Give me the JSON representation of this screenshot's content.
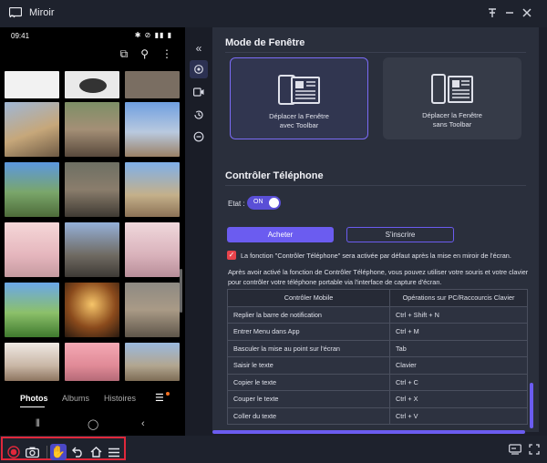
{
  "window": {
    "title": "Miroir",
    "buttons": [
      "pin",
      "minimize",
      "close"
    ]
  },
  "phone": {
    "status": {
      "time": "09:41"
    },
    "tabs": [
      {
        "label": "Photos",
        "active": true
      },
      {
        "label": "Albums",
        "active": false
      },
      {
        "label": "Histoires",
        "active": false
      }
    ]
  },
  "sidebar": {
    "items": [
      "collapse-icon",
      "settings-icon",
      "record-icon",
      "history-icon",
      "minus-icon"
    ],
    "selected": "settings-icon"
  },
  "settings": {
    "window_mode": {
      "title": "Mode de Fenêtre",
      "options": [
        {
          "line1": "Déplacer la Fenêtre",
          "line2": "avec Toolbar",
          "selected": true
        },
        {
          "line1": "Déplacer la Fenêtre",
          "line2": "sans Toolbar",
          "selected": false
        }
      ]
    },
    "phone_control": {
      "title": "Contrôler Téléphone",
      "state_label": "Etat :",
      "toggle_text": "ON",
      "buy_label": "Acheter",
      "register_label": "S'inscrire",
      "checkbox_text": "La fonction \"Contrôler Téléphone\" sera activée par défaut après la mise en miroir de l'écran.",
      "info_text": "Après avoir activé la fonction de Contrôler Téléphone, vous pouvez utiliser votre souris et votre clavier pour contrôler votre téléphone portable via l'interface de capture d'écran.",
      "table": {
        "headers": [
          "Contrôler Mobile",
          "Opérations sur PC/Raccourcis Clavier"
        ],
        "rows": [
          [
            "Replier la barre de notification",
            "Ctrl + Shift + N"
          ],
          [
            "Entrer Menu dans App",
            "Ctrl + M"
          ],
          [
            "Basculer la mise au point sur l'écran",
            "Tab"
          ],
          [
            "Saisir le texte",
            "Clavier"
          ],
          [
            "Copier le texte",
            "Ctrl + C"
          ],
          [
            "Couper le texte",
            "Ctrl + X"
          ],
          [
            "Coller du texte",
            "Ctrl + V"
          ]
        ]
      }
    }
  },
  "toolbar": {
    "left_tools": [
      "record-icon",
      "screenshot-icon",
      "hand-control-icon",
      "back-icon",
      "home-icon",
      "menu-icon"
    ],
    "right_tools": [
      "screen-settings-icon",
      "fullscreen-icon"
    ]
  },
  "colors": {
    "accent": "#6b5cf0",
    "record": "#e0283b",
    "panel_bg": "#2a2f3c"
  }
}
